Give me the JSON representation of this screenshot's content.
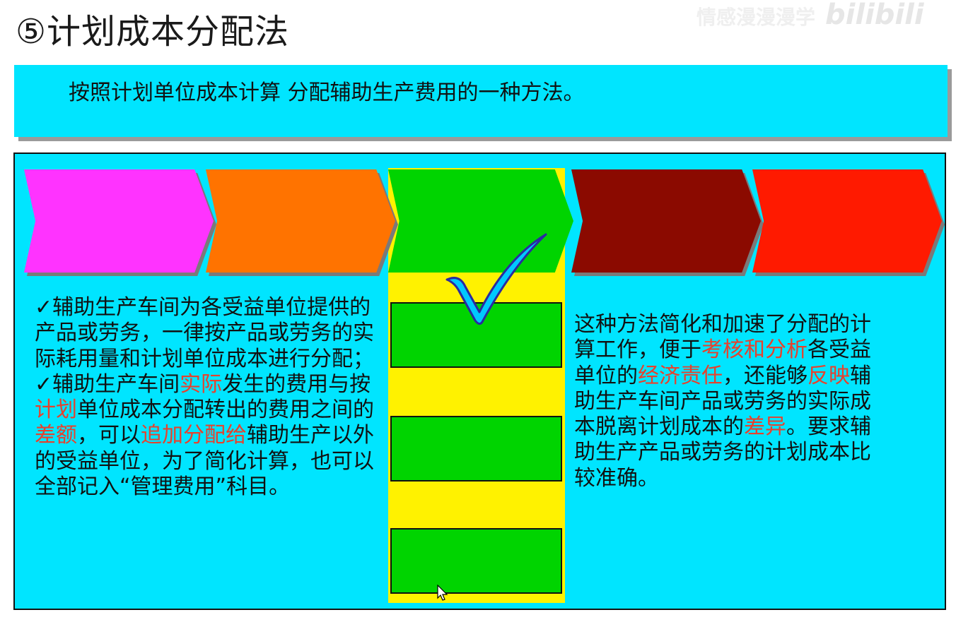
{
  "title": "⑤计划成本分配法",
  "watermark": {
    "text": "情感漫漫漫学",
    "logo": "bilibili"
  },
  "definition": "按照计划单位成本计算 分配辅助生产费用的一种方法。",
  "left_paragraphs": [
    [
      {
        "t": "✓辅助生产车间为各受益单位提供的产品或劳务，一律按产品或劳务的实际耗用量和计划单位成本进行分配；",
        "hl": false
      }
    ],
    [
      {
        "t": "✓辅助生产车间",
        "hl": false
      },
      {
        "t": "实际",
        "hl": true
      },
      {
        "t": "发生的费用与按",
        "hl": false
      },
      {
        "t": "计划",
        "hl": true
      },
      {
        "t": "单位成本分配转出的费用之间的",
        "hl": false
      },
      {
        "t": "差额",
        "hl": true
      },
      {
        "t": "，可以",
        "hl": false
      },
      {
        "t": "追加分配给",
        "hl": true
      },
      {
        "t": "辅助生产以外的受益单位，为了简化计算，也可以全部记入“管理费用”科目。",
        "hl": false
      }
    ]
  ],
  "right_paragraph": [
    {
      "t": "这种方法简化和加速了分配的计算工作，便于",
      "hl": false
    },
    {
      "t": "考核和分析",
      "hl": true
    },
    {
      "t": "各受益单位的",
      "hl": false
    },
    {
      "t": "经济责任",
      "hl": true
    },
    {
      "t": "，还能够",
      "hl": false
    },
    {
      "t": "反映",
      "hl": true
    },
    {
      "t": "辅助生产车间产品或劳务的实际成本脱离计划成本的",
      "hl": false
    },
    {
      "t": "差异",
      "hl": true
    },
    {
      "t": "。要求辅助生产产品或劳务的计划成本比较准确。",
      "hl": false
    }
  ],
  "colors": {
    "panel_bg": "#00e5ff",
    "highlight": "#e8412c",
    "chevrons": [
      "#ff33ff",
      "#ff7300",
      "#00d400",
      "#8b0a00",
      "#ff1a00"
    ],
    "yellow": "#fff200",
    "green": "#00d400",
    "check": "#00c8ff"
  },
  "icons": {
    "check": "check-mark-icon",
    "cursor": "mouse-pointer-icon"
  }
}
